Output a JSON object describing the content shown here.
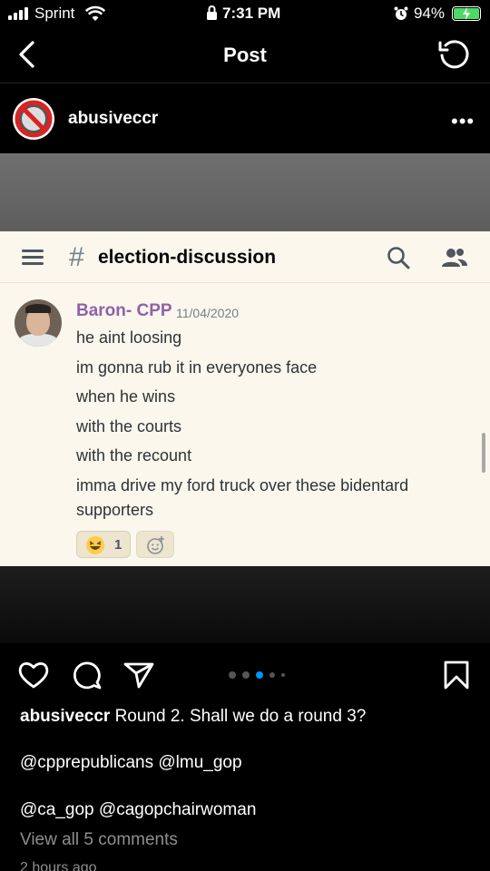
{
  "status": {
    "carrier": "Sprint",
    "time": "7:31 PM",
    "battery": "94%"
  },
  "nav": {
    "title": "Post",
    "back_icon": "chevron-left-icon",
    "refresh_icon": "refresh-icon"
  },
  "post": {
    "author": "abusiveccr",
    "more_label": "•••"
  },
  "screenshot": {
    "channel_hash": "#",
    "channel": "election-discussion",
    "message": {
      "author": "Baron- CPP",
      "date": "11/04/2020",
      "author_color": "#8e62a8",
      "lines": [
        "he aint loosing",
        "im gonna rub it in everyones face",
        "when he wins",
        "with the courts",
        "with the recount",
        "imma drive my ford truck over these bidentard supporters"
      ]
    },
    "reaction": {
      "emoji": "laughing-face-icon",
      "count": "1"
    }
  },
  "carousel": {
    "count": 5,
    "active_index": 2,
    "active_color": "#0095f6"
  },
  "caption": {
    "user": "abusiveccr",
    "text": " Round 2. Shall we do a round 3?",
    "mentions_line1": "@cpprepublicans @lmu_gop",
    "mentions_line2": "@ca_gop @cagopchairwoman",
    "view_comments": "View all 5 comments",
    "time_ago": "2 hours ago"
  }
}
